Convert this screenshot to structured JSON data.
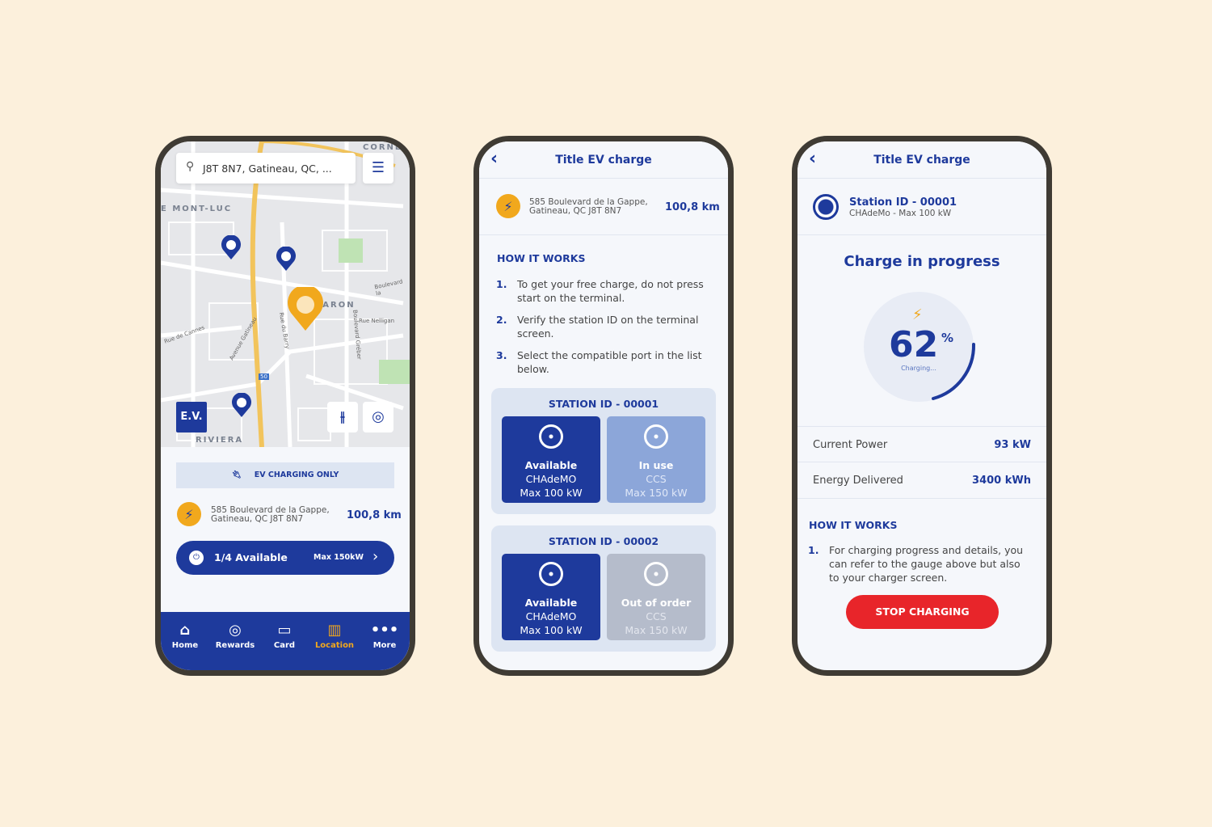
{
  "phone1": {
    "search": {
      "value": "J8T 8N7, Gatineau, QC, ..."
    },
    "map_labels": [
      "CORNE",
      "E MONT-LUC",
      "LE BARON",
      "RIVIERA",
      "Boulevard la",
      "Rue Nelligan",
      "Rue de Cannes",
      "Avenue Gatineau",
      "Rue du Barry",
      "Boulevard Gréber",
      "50"
    ],
    "ev_badge": "E.V.",
    "banner": "EV CHARGING ONLY",
    "address_line1": "585 Boulevard de la Gappe,",
    "address_line2": "Gatineau, QC J8T 8N7",
    "distance": "100,8 km",
    "availability": "1/4 Available",
    "max_power": "Max 150kW",
    "nav": [
      {
        "label": "Home",
        "icon": "home-icon"
      },
      {
        "label": "Rewards",
        "icon": "rewards-icon"
      },
      {
        "label": "Card",
        "icon": "card-icon"
      },
      {
        "label": "Location",
        "icon": "map-icon",
        "active": true
      },
      {
        "label": "More",
        "icon": "more-icon"
      }
    ]
  },
  "phone2": {
    "title": "Title EV charge",
    "address_line1": "585 Boulevard de la Gappe,",
    "address_line2": "Gatineau, QC J8T 8N7",
    "distance": "100,8 km",
    "how_title": "HOW IT WORKS",
    "steps": [
      {
        "n": "1.",
        "text": "To get your free charge, do not press start on the terminal."
      },
      {
        "n": "2.",
        "text": "Verify the station ID on the terminal screen."
      },
      {
        "n": "3.",
        "text": "Select the compatible port in the list below."
      }
    ],
    "stations": [
      {
        "title": "STATION ID - 00001",
        "ports": [
          {
            "status": "Available",
            "type": "CHAdeMO",
            "max": "Max 100 kW"
          },
          {
            "status": "In use",
            "type": "CCS",
            "max": "Max 150 kW"
          }
        ]
      },
      {
        "title": "STATION ID - 00002",
        "ports": [
          {
            "status": "Available",
            "type": "CHAdeMO",
            "max": "Max 100 kW"
          },
          {
            "status": "Out of order",
            "type": "CCS",
            "max": "Max 150 kW"
          }
        ]
      }
    ]
  },
  "phone3": {
    "title": "Title EV charge",
    "station_id": "Station ID - 00001",
    "station_sub": "CHAdeMo - Max 100 kW",
    "heading": "Charge in progress",
    "percent": "62",
    "percent_sign": "%",
    "charging_label": "Charging...",
    "rows": [
      {
        "label": "Current Power",
        "value": "93 kW"
      },
      {
        "label": "Energy Delivered",
        "value": "3400 kWh"
      }
    ],
    "how_title": "HOW IT WORKS",
    "steps": [
      {
        "n": "1.",
        "text": "For charging progress and details, you can refer to the gauge above but also to your charger screen."
      }
    ],
    "stop_label": "STOP CHARGING"
  },
  "colors": {
    "background": "#fcf0dc",
    "primary": "#1e3a9c",
    "accent": "#f1a81d",
    "danger": "#e8252a"
  }
}
